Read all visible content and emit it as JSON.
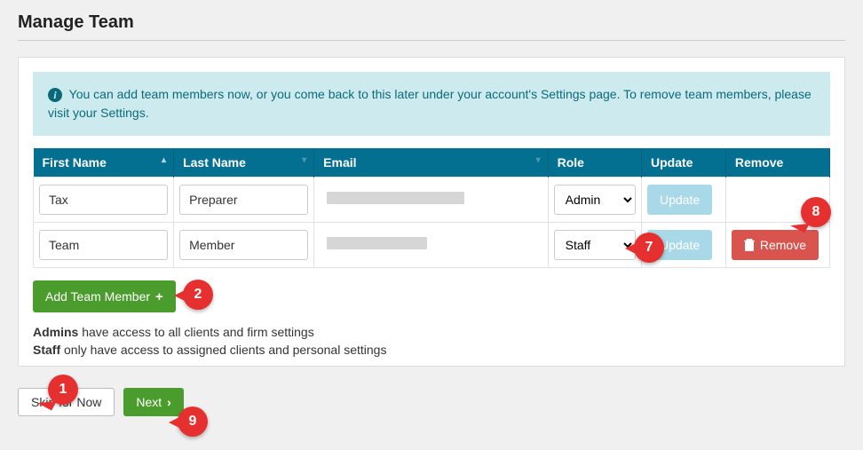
{
  "page_title": "Manage Team",
  "info_banner": "You can add team members now, or you come back to this later under your account's Settings page. To remove team members, please visit your Settings.",
  "columns": {
    "first_name": "First Name",
    "last_name": "Last Name",
    "email": "Email",
    "role": "Role",
    "update": "Update",
    "remove": "Remove"
  },
  "rows": [
    {
      "first_name": "Tax",
      "last_name": "Preparer",
      "email": "",
      "role": "Admin",
      "update_label": "Update",
      "remove_label": "",
      "removable": false
    },
    {
      "first_name": "Team",
      "last_name": "Member",
      "email": "",
      "role": "Staff",
      "update_label": "Update",
      "remove_label": "Remove",
      "removable": true
    }
  ],
  "add_team_member_label": "Add Team Member",
  "role_desc_admin_prefix": "Admins",
  "role_desc_admin_text": " have access to all clients and firm settings",
  "role_desc_staff_prefix": "Staff",
  "role_desc_staff_text": " only have access to assigned clients and personal settings",
  "skip_label": "Skip for Now",
  "next_label": "Next",
  "callouts": {
    "c1": "1",
    "c2": "2",
    "c7": "7",
    "c8": "8",
    "c9": "9"
  }
}
